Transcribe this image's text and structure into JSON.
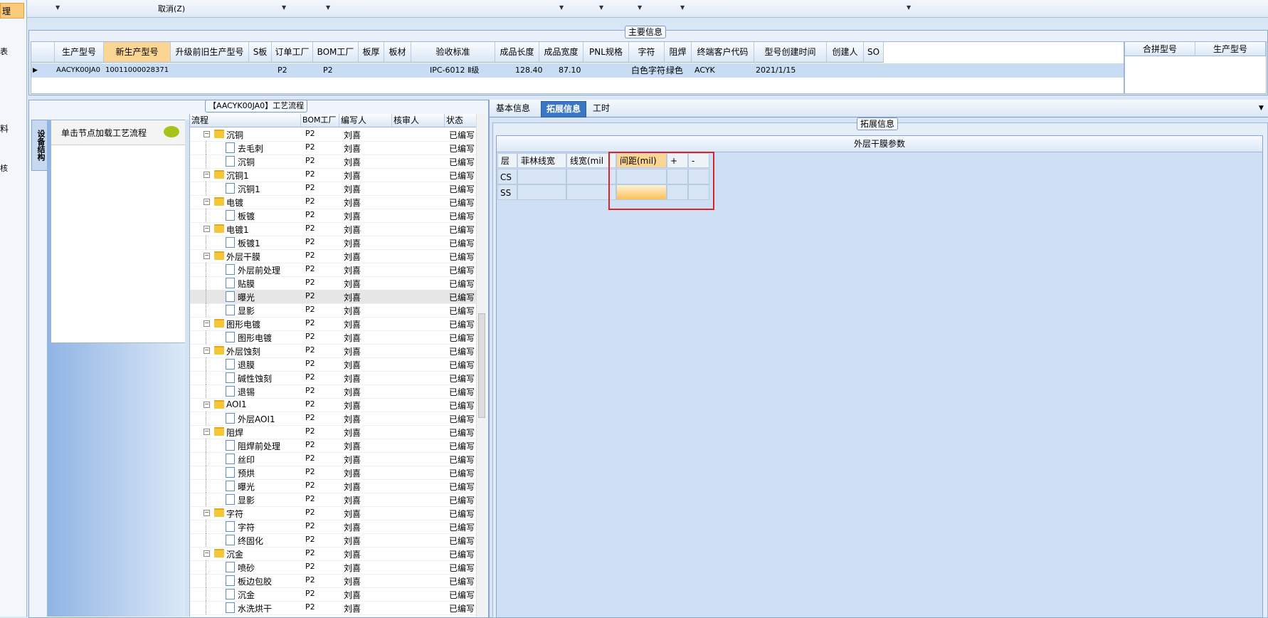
{
  "left_strip": {
    "items": [
      "理",
      "表",
      "料",
      "核"
    ]
  },
  "top_bar": {
    "cancel_label": "取消(Z)"
  },
  "main_info": {
    "title": "主要信息",
    "columns": [
      "生产型号",
      "新生产型号",
      "升级前旧生产型号",
      "S板",
      "订单工厂",
      "BOM工厂",
      "板厚",
      "板材",
      "验收标准",
      "成品长度",
      "成品宽度",
      "PNL规格",
      "字符",
      "阻焊",
      "终端客户代码",
      "型号创建时间",
      "创建人",
      "SO"
    ],
    "row": {
      "model": "AACYK00JA0",
      "new_model": "10011000028371",
      "order_factory": "P2",
      "bom_factory": "P2",
      "standard": "IPC-6012 Ⅱ级",
      "length": "128.40",
      "width": "87.10",
      "char": "白色字符",
      "solder": "绿色",
      "customer": "ACYK",
      "created": "2021/1/15"
    },
    "merge_columns": [
      "合拼型号",
      "生产型号"
    ]
  },
  "process": {
    "title": "【AACYK00JA0】工艺流程",
    "side_tab": "设备结构",
    "load_hint": "单击节点加载工艺流程",
    "columns": [
      "流程",
      "BOM工厂",
      "编写人",
      "核审人",
      "状态"
    ],
    "rows": [
      {
        "name": "沉铜",
        "level": 0,
        "bom": "P2",
        "writer": "刘喜",
        "status": "已编写"
      },
      {
        "name": "去毛刺",
        "level": 1,
        "bom": "P2",
        "writer": "刘喜",
        "status": "已编写"
      },
      {
        "name": "沉铜",
        "level": 1,
        "bom": "P2",
        "writer": "刘喜",
        "status": "已编写"
      },
      {
        "name": "沉铜1",
        "level": 0,
        "bom": "P2",
        "writer": "刘喜",
        "status": "已编写"
      },
      {
        "name": "沉铜1",
        "level": 1,
        "bom": "P2",
        "writer": "刘喜",
        "status": "已编写"
      },
      {
        "name": "电镀",
        "level": 0,
        "bom": "P2",
        "writer": "刘喜",
        "status": "已编写"
      },
      {
        "name": "板镀",
        "level": 1,
        "bom": "P2",
        "writer": "刘喜",
        "status": "已编写"
      },
      {
        "name": "电镀1",
        "level": 0,
        "bom": "P2",
        "writer": "刘喜",
        "status": "已编写"
      },
      {
        "name": "板镀1",
        "level": 1,
        "bom": "P2",
        "writer": "刘喜",
        "status": "已编写"
      },
      {
        "name": "外层干膜",
        "level": 0,
        "bom": "P2",
        "writer": "刘喜",
        "status": "已编写"
      },
      {
        "name": "外层前处理",
        "level": 1,
        "bom": "P2",
        "writer": "刘喜",
        "status": "已编写"
      },
      {
        "name": "贴膜",
        "level": 1,
        "bom": "P2",
        "writer": "刘喜",
        "status": "已编写"
      },
      {
        "name": "曝光",
        "level": 1,
        "bom": "P2",
        "writer": "刘喜",
        "status": "已编写",
        "selected": true
      },
      {
        "name": "显影",
        "level": 1,
        "bom": "P2",
        "writer": "刘喜",
        "status": "已编写"
      },
      {
        "name": "图形电镀",
        "level": 0,
        "bom": "P2",
        "writer": "刘喜",
        "status": "已编写"
      },
      {
        "name": "图形电镀",
        "level": 1,
        "bom": "P2",
        "writer": "刘喜",
        "status": "已编写"
      },
      {
        "name": "外层蚀刻",
        "level": 0,
        "bom": "P2",
        "writer": "刘喜",
        "status": "已编写"
      },
      {
        "name": "退膜",
        "level": 1,
        "bom": "P2",
        "writer": "刘喜",
        "status": "已编写"
      },
      {
        "name": "碱性蚀刻",
        "level": 1,
        "bom": "P2",
        "writer": "刘喜",
        "status": "已编写"
      },
      {
        "name": "退锡",
        "level": 1,
        "bom": "P2",
        "writer": "刘喜",
        "status": "已编写"
      },
      {
        "name": "AOI1",
        "level": 0,
        "bom": "P2",
        "writer": "刘喜",
        "status": "已编写"
      },
      {
        "name": "外层AOI1",
        "level": 1,
        "bom": "P2",
        "writer": "刘喜",
        "status": "已编写"
      },
      {
        "name": "阻焊",
        "level": 0,
        "bom": "P2",
        "writer": "刘喜",
        "status": "已编写"
      },
      {
        "name": "阻焊前处理",
        "level": 1,
        "bom": "P2",
        "writer": "刘喜",
        "status": "已编写"
      },
      {
        "name": "丝印",
        "level": 1,
        "bom": "P2",
        "writer": "刘喜",
        "status": "已编写"
      },
      {
        "name": "预烘",
        "level": 1,
        "bom": "P2",
        "writer": "刘喜",
        "status": "已编写"
      },
      {
        "name": "曝光",
        "level": 1,
        "bom": "P2",
        "writer": "刘喜",
        "status": "已编写"
      },
      {
        "name": "显影",
        "level": 1,
        "bom": "P2",
        "writer": "刘喜",
        "status": "已编写"
      },
      {
        "name": "字符",
        "level": 0,
        "bom": "P2",
        "writer": "刘喜",
        "status": "已编写"
      },
      {
        "name": "字符",
        "level": 1,
        "bom": "P2",
        "writer": "刘喜",
        "status": "已编写"
      },
      {
        "name": "终固化",
        "level": 1,
        "bom": "P2",
        "writer": "刘喜",
        "status": "已编写"
      },
      {
        "name": "沉金",
        "level": 0,
        "bom": "P2",
        "writer": "刘喜",
        "status": "已编写"
      },
      {
        "name": "喷砂",
        "level": 1,
        "bom": "P2",
        "writer": "刘喜",
        "status": "已编写"
      },
      {
        "name": "板边包胶",
        "level": 1,
        "bom": "P2",
        "writer": "刘喜",
        "status": "已编写"
      },
      {
        "name": "沉金",
        "level": 1,
        "bom": "P2",
        "writer": "刘喜",
        "status": "已编写"
      },
      {
        "name": "水洗烘干",
        "level": 1,
        "bom": "P2",
        "writer": "刘喜",
        "status": "已编写"
      }
    ]
  },
  "right": {
    "tabs": [
      "基本信息",
      "拓展信息",
      "工时"
    ],
    "active_tab": "拓展信息",
    "panel_title": "拓展信息",
    "grid_title": "外层干膜参数",
    "columns": [
      "层",
      "菲林线宽",
      "线宽(mil",
      "间距(mil)",
      "+",
      "-"
    ],
    "rows": [
      "CS",
      "SS"
    ]
  }
}
